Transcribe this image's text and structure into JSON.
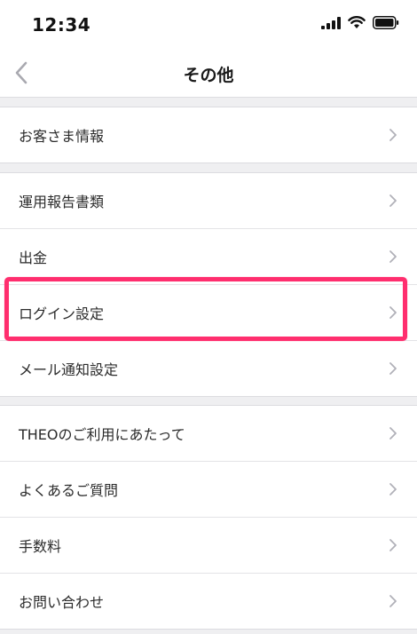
{
  "status_bar": {
    "time": "12:34"
  },
  "nav": {
    "title": "その他"
  },
  "groups": [
    {
      "items": [
        {
          "label": "お客さま情報"
        }
      ]
    },
    {
      "items": [
        {
          "label": "運用報告書類"
        },
        {
          "label": "出金"
        },
        {
          "label": "ログイン設定"
        },
        {
          "label": "メール通知設定"
        }
      ]
    },
    {
      "items": [
        {
          "label": "THEOのご利用にあたって"
        },
        {
          "label": "よくあるご質問"
        },
        {
          "label": "手数料"
        },
        {
          "label": "お問い合わせ"
        }
      ]
    }
  ],
  "colors": {
    "highlight": "#ff2e6e",
    "chevron": "#b0b0b8",
    "background": "#efeff1"
  },
  "icons": {
    "back": "chevron-left-icon",
    "row": "chevron-right-icon",
    "signal": "signal-icon",
    "wifi": "wifi-icon",
    "battery": "battery-icon"
  }
}
